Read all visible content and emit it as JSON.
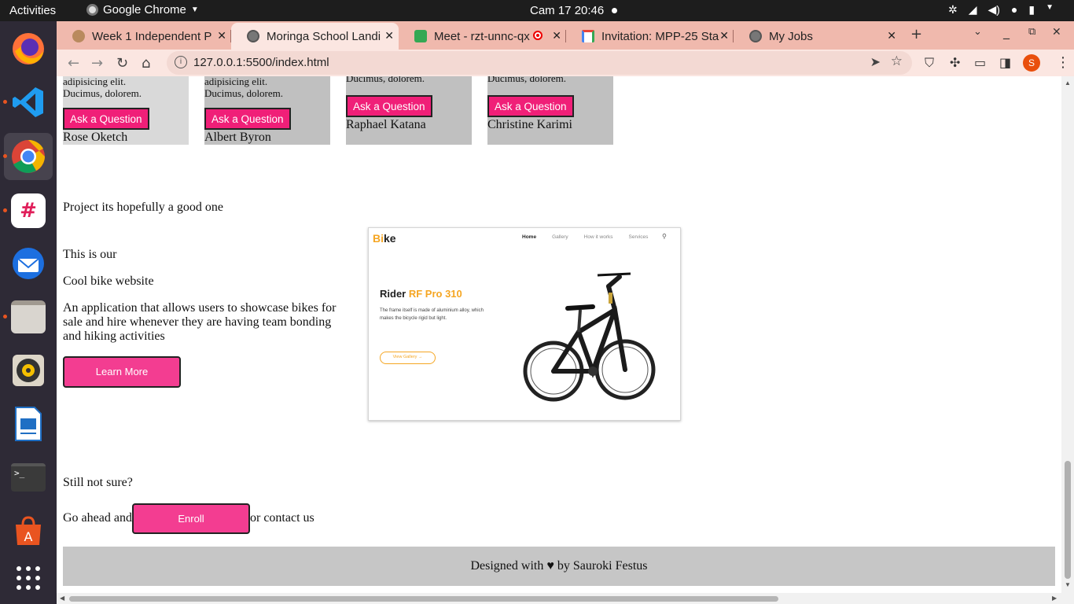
{
  "system_bar": {
    "activities": "Activities",
    "app_name": "Google Chrome",
    "clock": "Cam 17  20:46"
  },
  "browser": {
    "tabs": [
      {
        "title": "Week 1 Independent P",
        "favicon_color": "#b98a5e"
      },
      {
        "title": "Moringa School Landi",
        "favicon_color": "#555555"
      },
      {
        "title": "Meet - rzt-unnc-qx",
        "favicon_color": "#34a853"
      },
      {
        "title": "Invitation: MPP-25 Sta",
        "favicon_color": "#d93025"
      },
      {
        "title": "My Jobs",
        "favicon_color": "#555555"
      }
    ],
    "url": "127.0.0.1:5500/index.html",
    "profile_initial": "S"
  },
  "page": {
    "mentors": [
      {
        "desc": "adipisicing elit. Ducimus, dolorem.",
        "button": "Ask a Question",
        "name": "Rose Oketch"
      },
      {
        "desc": "adipisicing elit. Ducimus, dolorem.",
        "button": "Ask a Question",
        "name": "Albert Byron"
      },
      {
        "desc": "Ducimus, dolorem.",
        "button": "Ask a Question",
        "name": "Raphael Katana"
      },
      {
        "desc": "Ducimus, dolorem.",
        "button": "Ask a Question",
        "name": "Christine Karimi"
      }
    ],
    "project": {
      "heading": "Project its hopefully a good one",
      "intro": "This is our",
      "name": "Cool bike website",
      "description": "An application that allows users to showcase bikes for sale and hire whenever they are having team bonding and hiking activities",
      "learn_more": "Learn More"
    },
    "mockup": {
      "logo_plain": "Bi",
      "logo_accent": "ke",
      "nav": [
        "Home",
        "Gallery",
        "How it works",
        "Services"
      ],
      "title_plain": "Rider ",
      "title_accent": "RF Pro 310",
      "subtitle": "The frame itself is made of aluminium alloy, which makes the bicycle rigid but light.",
      "cta": "View Gallery →"
    },
    "cta": {
      "question": "Still not sure?",
      "lead": "Go ahead and",
      "enroll": "Enroll",
      "tail": "or contact us"
    },
    "footer": "Designed with ♥ by Sauroki Festus"
  }
}
